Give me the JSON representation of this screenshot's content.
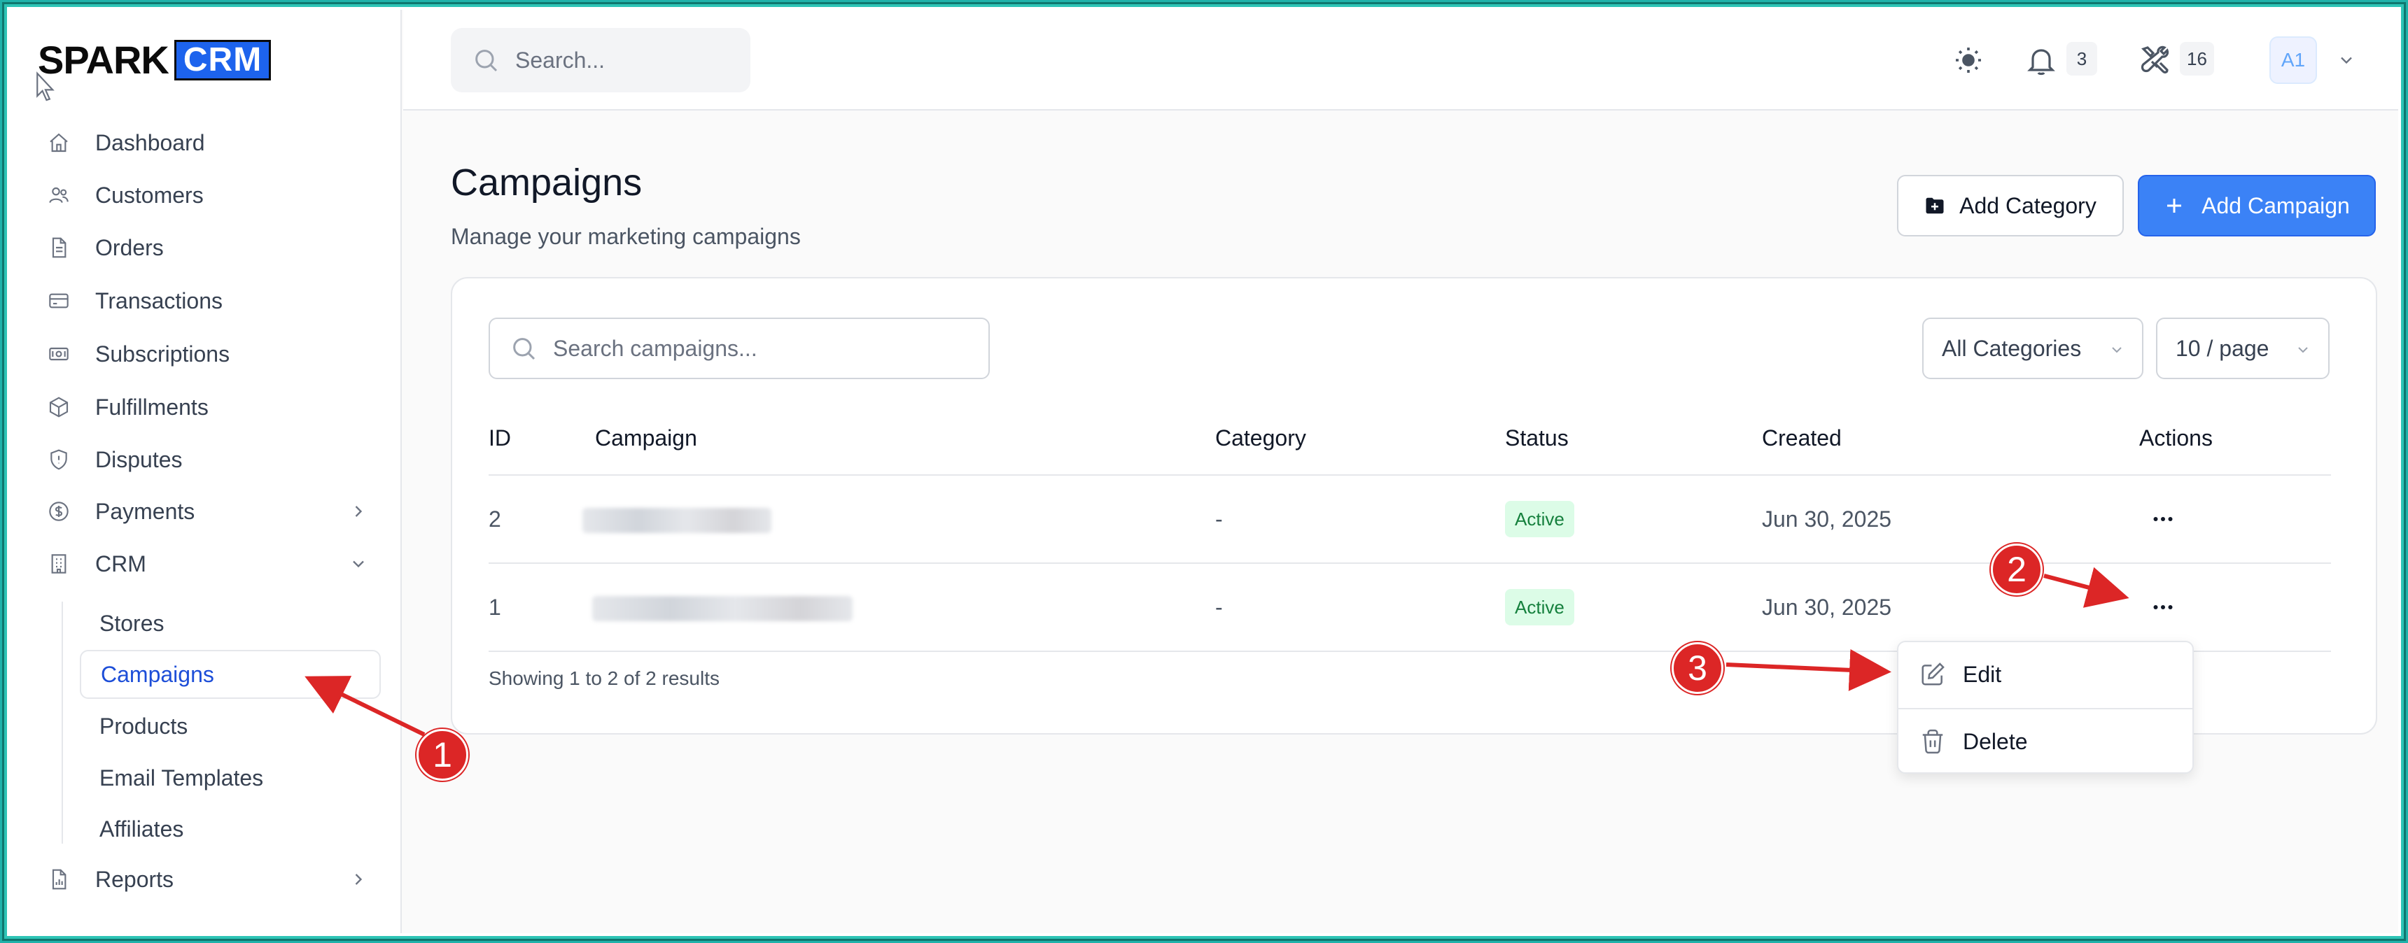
{
  "app": {
    "logo_word": "SPARK",
    "logo_badge": "CRM"
  },
  "sidebar": {
    "items": [
      {
        "label": "Dashboard",
        "icon": "home-icon"
      },
      {
        "label": "Customers",
        "icon": "users-icon"
      },
      {
        "label": "Orders",
        "icon": "document-icon"
      },
      {
        "label": "Transactions",
        "icon": "credit-card-icon"
      },
      {
        "label": "Subscriptions",
        "icon": "banknote-icon"
      },
      {
        "label": "Fulfillments",
        "icon": "package-icon"
      },
      {
        "label": "Disputes",
        "icon": "shield-icon"
      },
      {
        "label": "Payments",
        "icon": "dollar-circle-icon",
        "chevron": "right"
      },
      {
        "label": "CRM",
        "icon": "building-icon",
        "chevron": "down"
      },
      {
        "label": "Reports",
        "icon": "report-icon",
        "chevron": "right"
      }
    ],
    "crm_sub": [
      "Stores",
      "Campaigns",
      "Products",
      "Email Templates",
      "Affiliates"
    ],
    "active_sub": "Campaigns"
  },
  "topbar": {
    "search_placeholder": "Search...",
    "notifications_count": "3",
    "tools_count": "16",
    "avatar_initials": "A1"
  },
  "page": {
    "title": "Campaigns",
    "subtitle": "Manage your marketing campaigns",
    "add_category_label": "Add Category",
    "add_campaign_label": "Add Campaign"
  },
  "filters": {
    "search_placeholder": "Search campaigns...",
    "category_selected": "All Categories",
    "page_size_selected": "10 / page"
  },
  "table": {
    "columns": [
      "ID",
      "Campaign",
      "Category",
      "Status",
      "Created",
      "Actions"
    ],
    "rows": [
      {
        "id": "2",
        "campaign": "",
        "category": "-",
        "status": "Active",
        "created": "Jun 30, 2025"
      },
      {
        "id": "1",
        "campaign": "",
        "category": "-",
        "status": "Active",
        "created": "Jun 30, 2025"
      }
    ],
    "showing_text": "Showing 1 to 2 of 2 results"
  },
  "row_menu": {
    "edit_label": "Edit",
    "delete_label": "Delete"
  },
  "annotations": [
    "1",
    "2",
    "3"
  ],
  "colors": {
    "accent": "#3b82f6",
    "active_nav": "#1d4ed8",
    "status_bg": "#dcfce7",
    "status_text": "#15803d",
    "annotation": "#dc2626",
    "frame": "#2ec4b6"
  }
}
